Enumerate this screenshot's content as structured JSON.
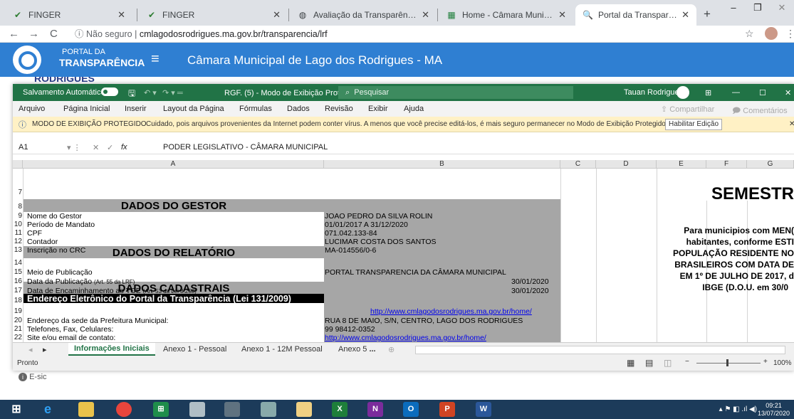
{
  "browser": {
    "tabs": [
      {
        "label": "FINGER",
        "icon": "finger-icon"
      },
      {
        "label": "FINGER",
        "icon": "finger-icon"
      },
      {
        "label": "Avaliação da Transparência dos",
        "icon": "globe-icon"
      },
      {
        "label": "Home - Câmara Municipal de La",
        "icon": "excel-icon"
      },
      {
        "label": "Portal da Transparência :: Câma",
        "icon": "search-icon"
      }
    ],
    "security": "Não seguro",
    "url": "cmlagodosrodrigues.ma.gov.br/transparencia/lrf"
  },
  "portal": {
    "title_line1": "PORTAL DA",
    "title_line2": "TRANSPARÊNCIA",
    "header": "Câmara Municipal de Lago dos Rodrigues - MA",
    "below_text": "RODRIGUES"
  },
  "excel": {
    "autosave": "Salvamento Automático",
    "filename": "RGF. (5)  -  Modo de Exibição Protegido  ▾",
    "search": "Pesquisar",
    "user": "Tauan Rodrigues",
    "menu": [
      "Arquivo",
      "Página Inicial",
      "Inserir",
      "Layout da Página",
      "Fórmulas",
      "Dados",
      "Revisão",
      "Exibir",
      "Ajuda"
    ],
    "share": "Compartilhar",
    "comments": "Comentários",
    "protected_title": "MODO DE EXIBIÇÃO PROTEGIDO",
    "protected_msg": "Cuidado, pois arquivos provenientes da Internet podem conter vírus. A menos que você precise editá-los, é mais seguro permanecer no Modo de Exibição Protegido.",
    "enable_edit": "Habilitar Edição",
    "cell_ref": "A1",
    "formula": "PODER LEGISLATIVO - CÂMARA MUNICIPAL",
    "columns": [
      "A",
      "B",
      "C",
      "D",
      "E",
      "F",
      "G"
    ],
    "rows": {
      "r7": "7",
      "r8": "8",
      "r9": "9",
      "r10": "10",
      "r11": "11",
      "r12": "12",
      "r13": "13",
      "r14": "14",
      "r15": "15",
      "r16": "16",
      "r17": "17",
      "r18": "18",
      "r19": "19",
      "r20": "20",
      "r21": "21",
      "r22": "22"
    },
    "cells": {
      "dados_gestor": "DADOS DO GESTOR",
      "nome_gestor": "Nome do Gestor",
      "nome_gestor_v": "JOAO PEDRO DA SILVA ROLIN",
      "periodo": "Período de Mandato",
      "periodo_v": "01/01/2017 A 31/12/2020",
      "cpf": "CPF",
      "cpf_v": "071.042.133-84",
      "contador": "Contador",
      "contador_v": "LUCIMAR COSTA DOS SANTOS",
      "crc": "Inscrição no CRC",
      "crc_v": "MA-014556/0-6",
      "dados_relatorio": "DADOS DO RELATÓRIO",
      "meio": "Meio de Publicação",
      "meio_v": "PORTAL TRANSPARENCIA DA CÂMARA MUNICIPAL",
      "data_pub": "Data da Publicação",
      "data_pub_note": "(Art. 55 da LRF)",
      "data_pub_v": "30/01/2020",
      "data_enc": "Data de Encaminhamento ao TCE",
      "data_enc_note": "(Art. 53 da Lei 8.258)",
      "data_enc_v": "30/01/2020",
      "dados_cad": "DADOS CADASTRAIS",
      "endereco_portal": "Endereço Eletrônico do Portal da Transparência (Lei 131/2009)",
      "endereco_portal_v": "http://www.cmlagodosrodrigues.ma.gov.br/home/",
      "sede": "Endereço da sede da Prefeitura Municipal:",
      "sede_v": "RUA 8 DE MAIO, S/N, CENTRO, LAGO DOS RODRIGUES",
      "telefones": "Telefones, Fax, Celulares:",
      "telefones_v": "99 98412-0352",
      "site": "Site e/ou email de contato:",
      "site_v": "http://www.cmlagodosrodrigues.ma.gov.br/home/",
      "semestre": "SEMESTR",
      "sem_l1": "Para municipios com MEN(",
      "sem_l2": "habitantes, conforme ESTI",
      "sem_l3": "POPULAÇÃO RESIDENTE NO",
      "sem_l4": "BRASILEIROS COM DATA DE",
      "sem_l5": "EM 1º DE JULHO DE 2017, d",
      "sem_l6": "IBGE (D.O.U. em 30/0"
    },
    "sheets": [
      "Informações Iniciais",
      "Anexo 1 - Pessoal",
      "Anexo 1 - 12M Pessoal",
      "Anexo 5"
    ],
    "status": "Pronto",
    "zoom": "100%"
  },
  "under": {
    "esic": "E-sic"
  },
  "taskbar": {
    "time": "09:21",
    "date": "13/07/2020"
  }
}
